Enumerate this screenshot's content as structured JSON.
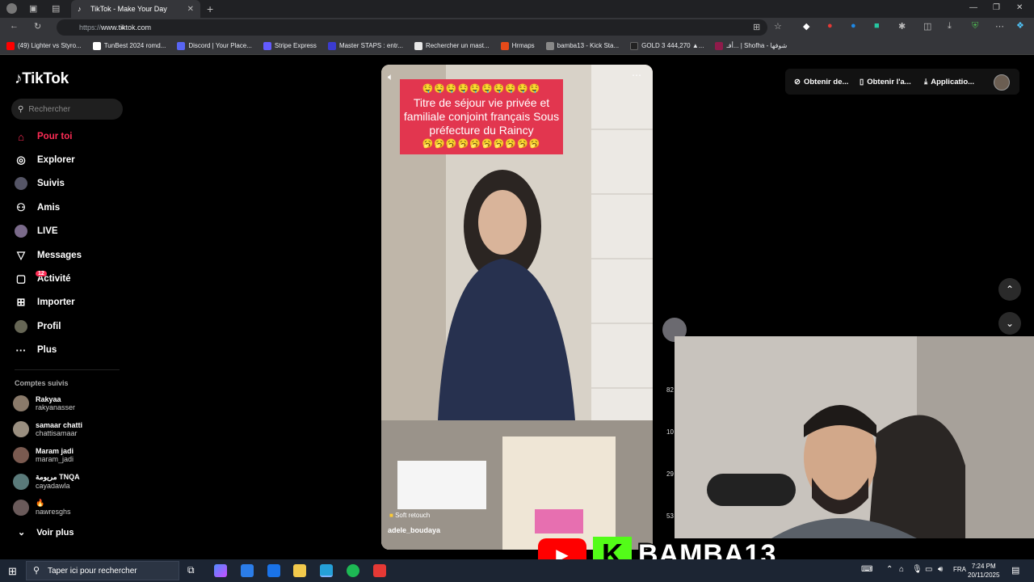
{
  "browser": {
    "tab_title": "TikTok - Make Your Day",
    "url_prefix": "https://",
    "url_host": "www.tiktok.com",
    "bookmarks": [
      {
        "label": "(49) Lighter vs Styro...",
        "color": "#ff0000"
      },
      {
        "label": "TunBest 2024 romd...",
        "color": "#ffffff"
      },
      {
        "label": "Discord | Your Place...",
        "color": "#5865f2"
      },
      {
        "label": "Stripe Express",
        "color": "#635bff"
      },
      {
        "label": "Master STAPS : entr...",
        "color": "#3b3bd0"
      },
      {
        "label": "Rechercher un mast...",
        "color": "#e8e8e8"
      },
      {
        "label": "Hrmaps",
        "color": "#e64a19"
      },
      {
        "label": "bamba13 - Kick Sta...",
        "color": "#888888"
      },
      {
        "label": "GOLD 3 444,270 ▲...",
        "color": "#222222"
      },
      {
        "label": "أفـ... | Shofha - شوفها",
        "color": "#8e1b4a"
      }
    ]
  },
  "tiktok": {
    "logo": "TikTok",
    "search_placeholder": "Rechercher",
    "nav": [
      {
        "label": "Pour toi",
        "icon": "home-icon",
        "glyph": "⌂",
        "active": true
      },
      {
        "label": "Explorer",
        "icon": "compass-icon",
        "glyph": "◎"
      },
      {
        "label": "Suivis",
        "icon": "following-avatar-icon",
        "glyph": "●"
      },
      {
        "label": "Amis",
        "icon": "friends-icon",
        "glyph": "⚇"
      },
      {
        "label": "LIVE",
        "icon": "live-icon",
        "glyph": "◉"
      },
      {
        "label": "Messages",
        "icon": "messages-icon",
        "glyph": "▽"
      },
      {
        "label": "Activité",
        "icon": "activity-icon",
        "glyph": "▢",
        "badge": "12"
      },
      {
        "label": "Importer",
        "icon": "upload-icon",
        "glyph": "⊞"
      },
      {
        "label": "Profil",
        "icon": "profile-avatar-icon",
        "glyph": "●"
      },
      {
        "label": "Plus",
        "icon": "more-icon",
        "glyph": "···"
      }
    ],
    "following_title": "Comptes suivis",
    "following": [
      {
        "name": "Rakyaa",
        "handle": "rakyanasser"
      },
      {
        "name": "samaar chatti",
        "handle": "chattisamaar"
      },
      {
        "name": "Maram jadi",
        "handle": "maram_jadi"
      },
      {
        "name": "مريومة TNQA",
        "handle": "cayadawla"
      },
      {
        "name": "🔥",
        "handle": "nawresghs"
      }
    ],
    "see_more": "Voir plus",
    "top_right": {
      "btn1": "Obtenir de...",
      "btn2": "Obtenir l'a...",
      "btn3": "Applicatio..."
    },
    "video": {
      "emoji_row_top": "🤤🤤🤤🤤🤤🤤🤤🤤🤤🤤",
      "caption": "Titre de séjour vie privée et familiale conjoint français Sous préfecture du Raincy",
      "emoji_row_bottom": "🥱🥱🥱🥱🥱🥱🥱🥱🥱🥱",
      "effect": "Soft retouch",
      "username": "adele_boudaya"
    },
    "side_counts": [
      "82",
      "10",
      "29",
      "53"
    ]
  },
  "stream": {
    "channel": "BAMBA13",
    "kick_letter": "K"
  },
  "taskbar": {
    "search_placeholder": "Taper ici pour rechercher",
    "lang": "FRA",
    "time": "7:24 PM",
    "date": "20/11/2025"
  }
}
